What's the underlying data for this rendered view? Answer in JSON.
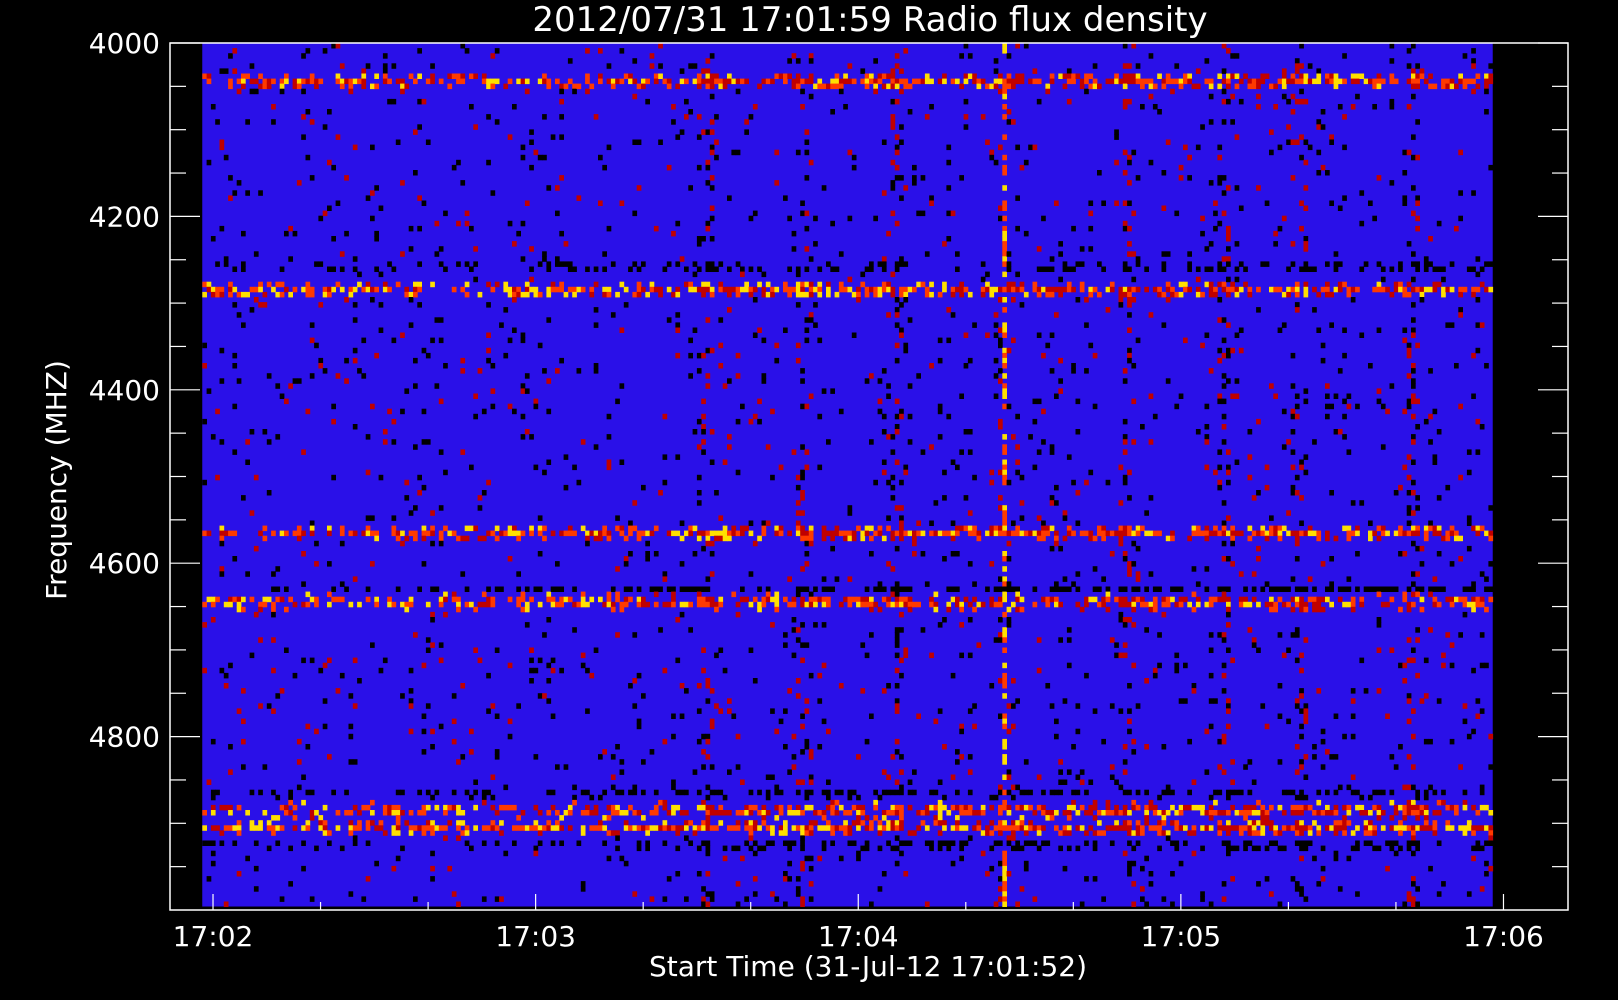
{
  "chart_data": {
    "type": "heatmap",
    "title": "2012/07/31 17:01:59 Radio flux density",
    "xlabel": "Start Time (31-Jul-12 17:01:52)",
    "ylabel": "Frequency (MHZ)",
    "x_ticks": [
      {
        "value": "17:02:00",
        "label": "17:02"
      },
      {
        "value": "17:03:00",
        "label": "17:03"
      },
      {
        "value": "17:04:00",
        "label": "17:04"
      },
      {
        "value": "17:05:00",
        "label": "17:05"
      },
      {
        "value": "17:06:00",
        "label": "17:06"
      }
    ],
    "y_ticks": [
      {
        "value": 4000,
        "label": "4000"
      },
      {
        "value": 4200,
        "label": "4200"
      },
      {
        "value": 4400,
        "label": "4400"
      },
      {
        "value": 4600,
        "label": "4600"
      },
      {
        "value": 4800,
        "label": "4800"
      }
    ],
    "xlim": [
      "17:01:52",
      "17:06:12"
    ],
    "ylim": [
      4000,
      5000
    ],
    "data_extent_x": [
      "17:01:58",
      "17:05:58"
    ],
    "data_extent_y": [
      4000,
      4996
    ],
    "colormap": [
      "#000000",
      "#2a10e8",
      "#c00000",
      "#ff3a00",
      "#ffe000"
    ],
    "background_color": "#2a10e8",
    "bright_bands_mhz": [
      4044,
      4285,
      4565,
      4645,
      4905,
      4885
    ],
    "dark_bands_mhz": [
      4258,
      4630,
      4865,
      4925
    ],
    "active_times": [
      "17:03:32",
      "17:03:50",
      "17:04:07",
      "17:04:27",
      "17:04:50",
      "17:05:08",
      "17:05:22",
      "17:05:43"
    ],
    "burst_time": "17:04:27",
    "grid": false,
    "legend": "none"
  }
}
